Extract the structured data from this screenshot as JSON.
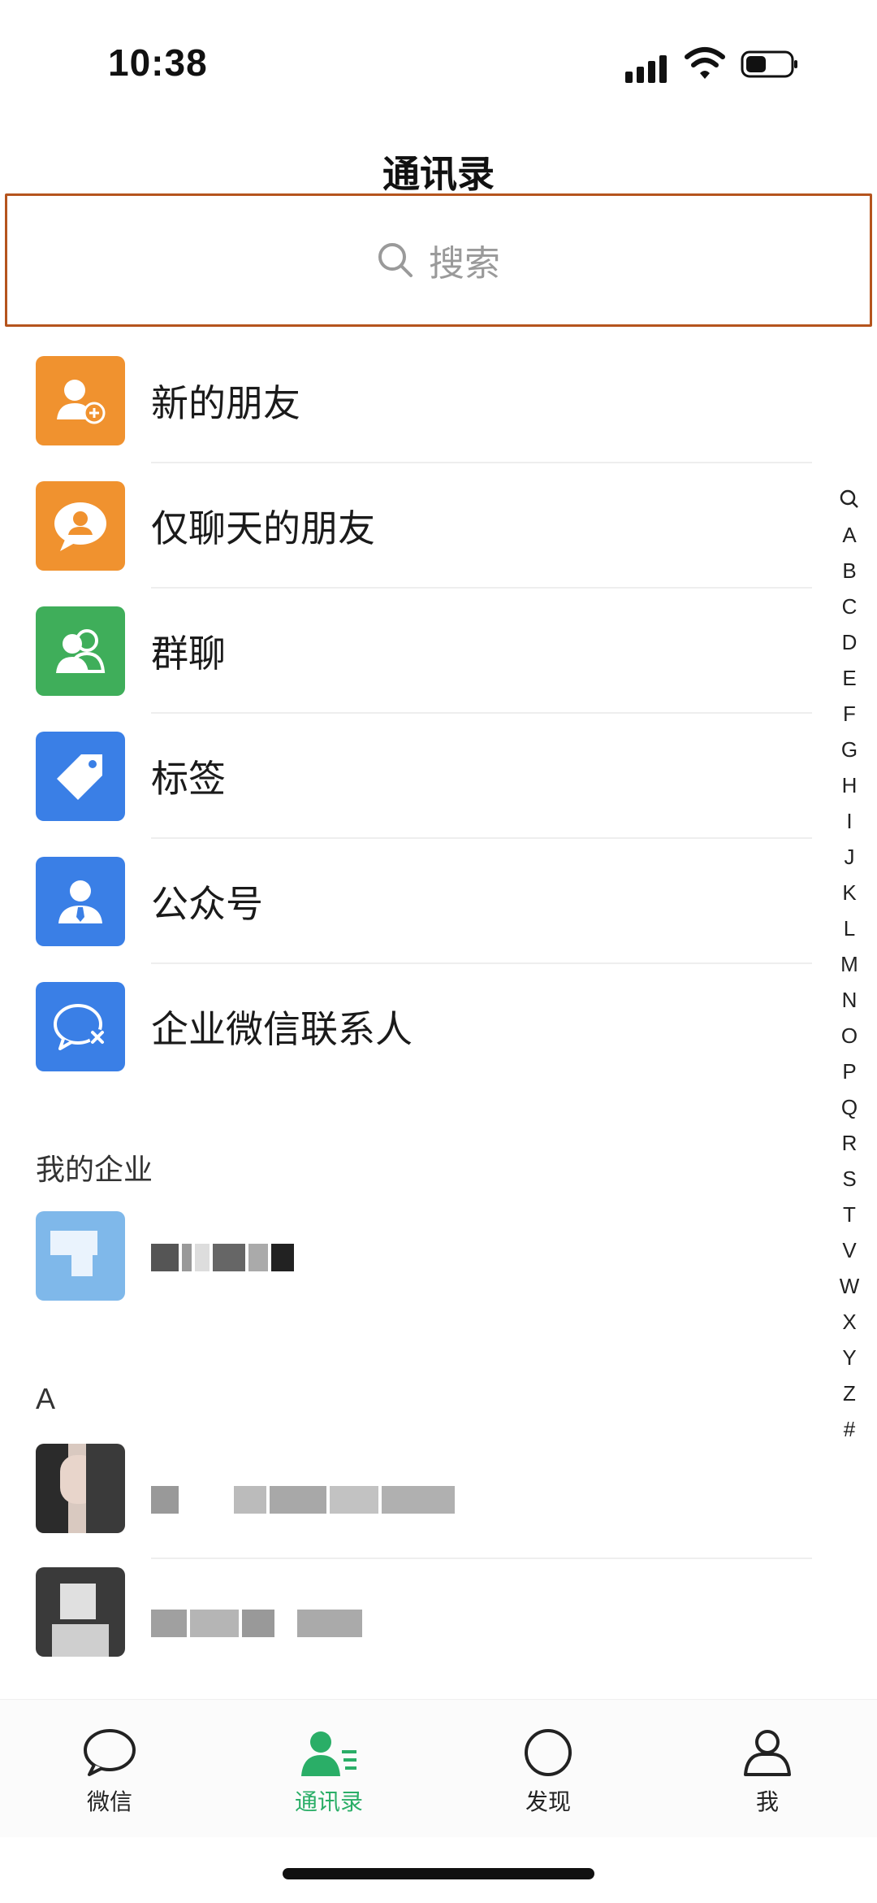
{
  "status": {
    "time": "10:38"
  },
  "header": {
    "title": "通讯录"
  },
  "search": {
    "placeholder": "搜索"
  },
  "functions": [
    {
      "label": "新的朋友",
      "icon": "add-friend-icon",
      "color": "#f0922f"
    },
    {
      "label": "仅聊天的朋友",
      "icon": "chat-only-friend-icon",
      "color": "#f0922f"
    },
    {
      "label": "群聊",
      "icon": "group-chat-icon",
      "color": "#3fae5a"
    },
    {
      "label": "标签",
      "icon": "tag-icon",
      "color": "#3a7fe6"
    },
    {
      "label": "公众号",
      "icon": "official-account-icon",
      "color": "#3a7fe6"
    },
    {
      "label": "企业微信联系人",
      "icon": "wecom-contact-icon",
      "color": "#3a7fe6"
    }
  ],
  "sections": {
    "enterprise": "我的企业",
    "a": "A"
  },
  "index_letters": [
    "A",
    "B",
    "C",
    "D",
    "E",
    "F",
    "G",
    "H",
    "I",
    "J",
    "K",
    "L",
    "M",
    "N",
    "O",
    "P",
    "Q",
    "R",
    "S",
    "T",
    "V",
    "W",
    "X",
    "Y",
    "Z",
    "#"
  ],
  "tabs": [
    {
      "label": "微信",
      "icon": "chat-bubble-icon",
      "active": false
    },
    {
      "label": "通讯录",
      "icon": "contacts-icon",
      "active": true
    },
    {
      "label": "发现",
      "icon": "discover-icon",
      "active": false
    },
    {
      "label": "我",
      "icon": "me-icon",
      "active": false
    }
  ],
  "colors": {
    "accent": "#2aae67",
    "search_border": "#b5541d"
  }
}
